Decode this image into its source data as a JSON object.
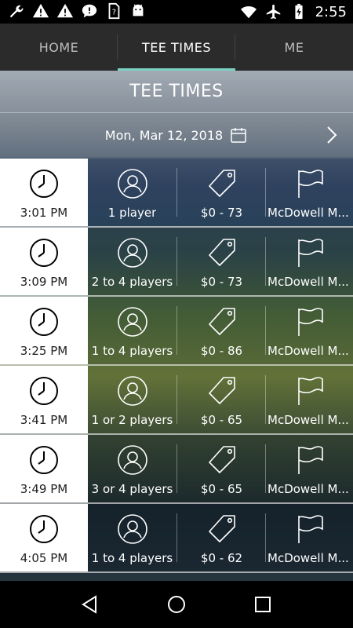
{
  "status_bar": {
    "time": "2:55",
    "left_icons": [
      "wrench-icon",
      "warning-icon",
      "warning-icon",
      "chat-alert-icon",
      "unknown-sim-icon",
      "android-icon"
    ],
    "right_icons": [
      "wifi-icon",
      "airplane-icon",
      "battery-icon"
    ]
  },
  "tabs": [
    {
      "label": "HOME",
      "active": false
    },
    {
      "label": "TEE TIMES",
      "active": true
    },
    {
      "label": "ME",
      "active": false
    }
  ],
  "header": {
    "title": "TEE TIMES"
  },
  "date_bar": {
    "date": "Mon, Mar 12, 2018"
  },
  "tee_times": [
    {
      "time": "3:01 PM",
      "players": "1 player",
      "price": "$0 - 73",
      "course": "McDowell M..."
    },
    {
      "time": "3:09 PM",
      "players": "2 to 4 players",
      "price": "$0 - 73",
      "course": "McDowell M..."
    },
    {
      "time": "3:25 PM",
      "players": "1 to 4 players",
      "price": "$0 - 86",
      "course": "McDowell M..."
    },
    {
      "time": "3:41 PM",
      "players": "1 or 2 players",
      "price": "$0 - 65",
      "course": "McDowell M..."
    },
    {
      "time": "3:49 PM",
      "players": "3 or 4 players",
      "price": "$0 - 65",
      "course": "McDowell M..."
    },
    {
      "time": "4:05 PM",
      "players": "1 to 4 players",
      "price": "$0 - 62",
      "course": "McDowell M..."
    }
  ],
  "colors": {
    "accent": "#7ad3c3",
    "tab_bg": "#2b2b2b"
  }
}
